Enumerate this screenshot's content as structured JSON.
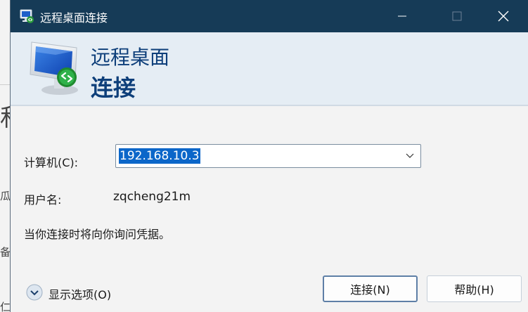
{
  "window": {
    "title": "远程桌面连接",
    "title_icon": "remote-desktop-icon"
  },
  "banner": {
    "line1": "远程桌面",
    "line2": "连接",
    "icon": "remote-desktop-monitor-icon"
  },
  "form": {
    "computer_label": "计算机(C):",
    "computer_value": "192.168.10.3",
    "user_label": "用户名:",
    "user_value": "zqcheng21m",
    "info_text": "当你连接时将向你询问凭据。"
  },
  "footer": {
    "options_label": "显示选项(O)",
    "connect_label": "连接(N)",
    "help_label": "帮助(H)"
  },
  "background": {
    "fragments": [
      "私",
      "瓜",
      "备",
      "仁"
    ]
  },
  "colors": {
    "titlebar": "#163b57",
    "banner": "#e5edf4",
    "accent": "#0b66c9",
    "banner_text": "#0e3f7a"
  }
}
